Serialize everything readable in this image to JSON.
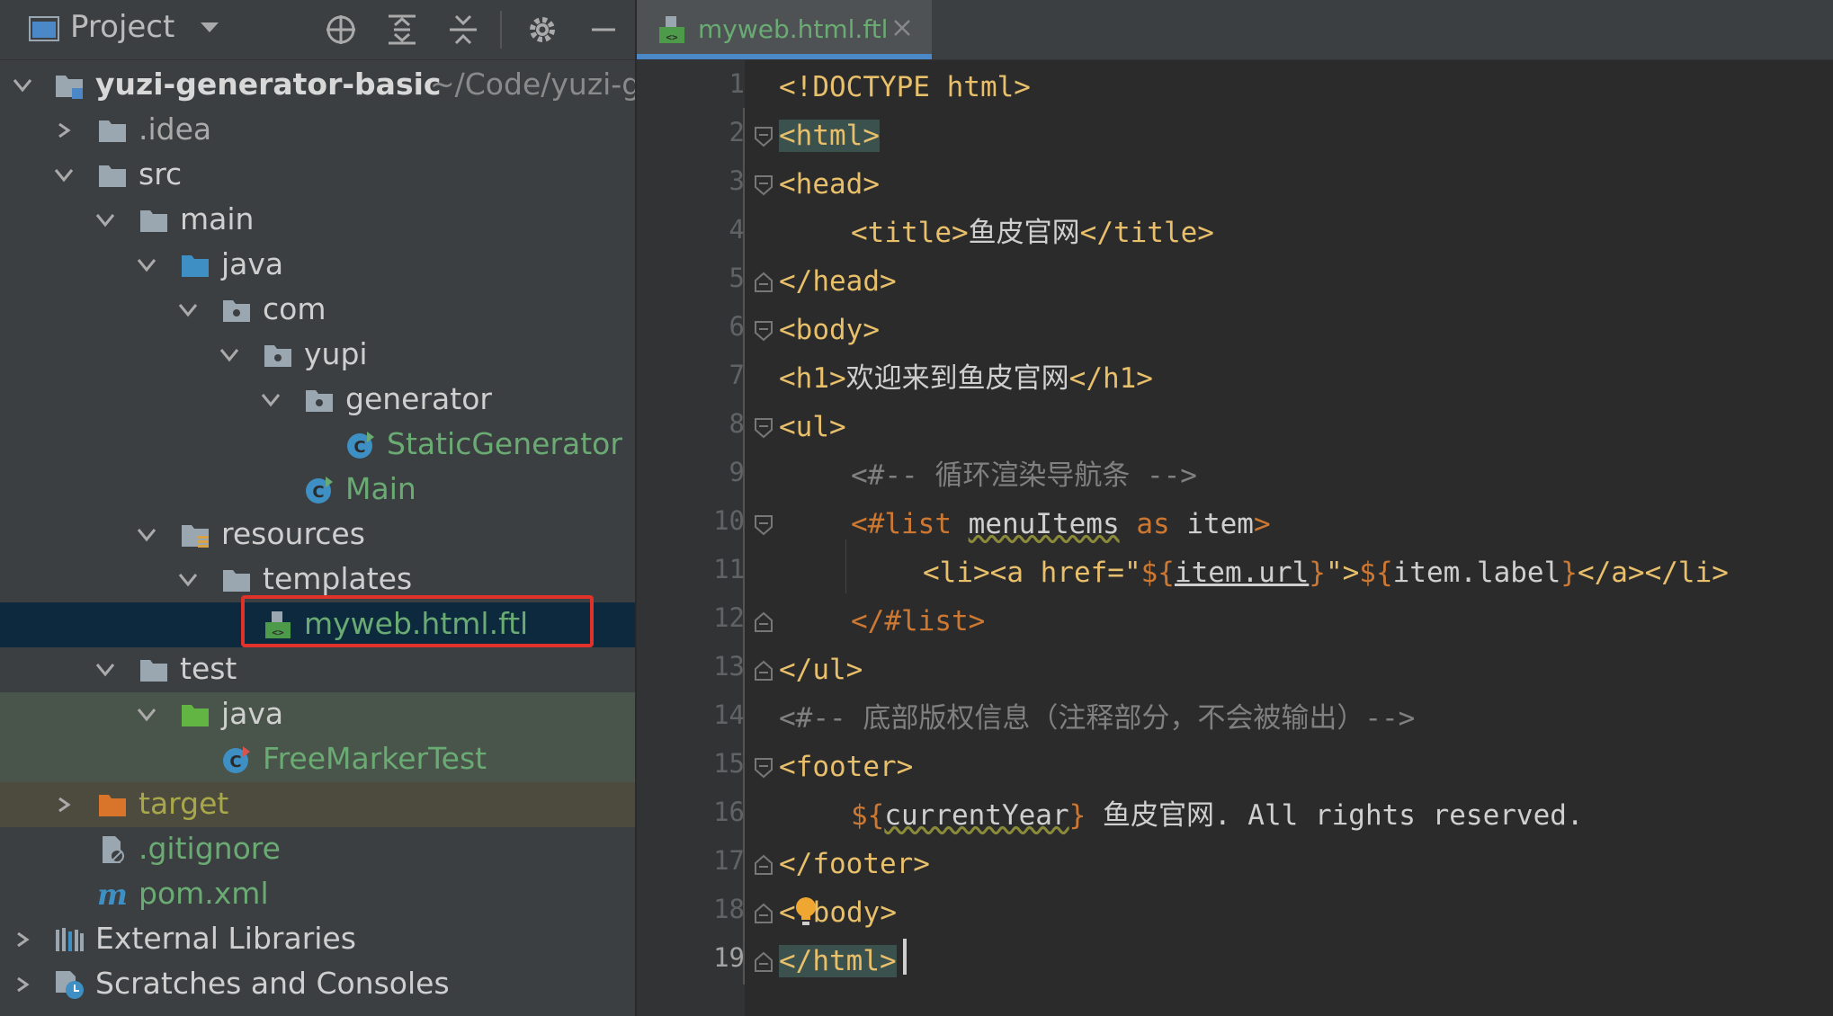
{
  "project_panel": {
    "title": "Project",
    "toolbar_icons": [
      "crosshair-icon",
      "expand-all-icon",
      "collapse-all-icon",
      "gear-icon",
      "minimize-icon"
    ]
  },
  "tree": [
    {
      "label": "yuzi-generator-basic",
      "suffix": "~/Code/yuzi-g",
      "icon": "module-folder-icon",
      "expanded": true
    },
    {
      "label": ".idea",
      "icon": "folder-icon",
      "expanded": false
    },
    {
      "label": "src",
      "icon": "folder-icon",
      "expanded": true
    },
    {
      "label": "main",
      "icon": "folder-icon",
      "expanded": true
    },
    {
      "label": "java",
      "icon": "source-folder-icon",
      "expanded": true
    },
    {
      "label": "com",
      "icon": "package-icon",
      "expanded": true
    },
    {
      "label": "yupi",
      "icon": "package-icon",
      "expanded": true
    },
    {
      "label": "generator",
      "icon": "package-icon",
      "expanded": true
    },
    {
      "label": "StaticGenerator",
      "icon": "java-class-icon"
    },
    {
      "label": "Main",
      "icon": "java-class-icon"
    },
    {
      "label": "resources",
      "icon": "resources-folder-icon",
      "expanded": true
    },
    {
      "label": "templates",
      "icon": "folder-icon",
      "expanded": true
    },
    {
      "label": "myweb.html.ftl",
      "icon": "ftl-file-icon",
      "selected": true
    },
    {
      "label": "test",
      "icon": "folder-icon",
      "expanded": true
    },
    {
      "label": "java",
      "icon": "test-source-folder-icon",
      "expanded": true
    },
    {
      "label": "FreeMarkerTest",
      "icon": "java-class-icon"
    },
    {
      "label": "target",
      "icon": "excluded-folder-icon",
      "expanded": false
    },
    {
      "label": ".gitignore",
      "icon": "gitignore-file-icon"
    },
    {
      "label": "pom.xml",
      "icon": "maven-icon"
    },
    {
      "label": "External Libraries",
      "icon": "libraries-icon",
      "expanded": false
    },
    {
      "label": "Scratches and Consoles",
      "icon": "scratches-icon",
      "expanded": false
    }
  ],
  "editor": {
    "tab": {
      "label": "myweb.html.ftl",
      "icon": "ftl-file-icon"
    },
    "line_numbers": [
      "1",
      "2",
      "3",
      "4",
      "5",
      "6",
      "7",
      "8",
      "9",
      "10",
      "11",
      "12",
      "13",
      "14",
      "15",
      "16",
      "17",
      "18",
      "19"
    ],
    "current_line": "19",
    "code": {
      "l1": "<!DOCTYPE html>",
      "l2": "<html>",
      "l3": "<head>",
      "l4_open": "<title>",
      "l4_text": "鱼皮官网",
      "l4_close": "</title>",
      "l5": "</head>",
      "l6": "<body>",
      "l7_open": "<h1>",
      "l7_text": "欢迎来到鱼皮官网",
      "l7_close": "</h1>",
      "l8": "<ul>",
      "l9": "<#-- 循环渲染导航条 -->",
      "l10_kw": "<#list",
      "l10_var": "menuItems",
      "l10_as": "as",
      "l10_item": "item",
      "l10_end": ">",
      "l11_a": "<li><a href=",
      "l11_q1": "\"",
      "l11_d1": "${",
      "l11_v1": "item.url",
      "l11_c1": "}",
      "l11_q2": "\"",
      "l11_gt": ">",
      "l11_d2": "${",
      "l11_v2": "item.label",
      "l11_c2": "}",
      "l11_end": "</a></li>",
      "l12": "</#list>",
      "l13": "</ul>",
      "l14": "<#-- 底部版权信息（注释部分，不会被输出）-->",
      "l15": "<footer>",
      "l16_d": "${",
      "l16_v": "currentYear",
      "l16_c": "}",
      "l16_text": " 鱼皮官网. All rights reserved.",
      "l17": "</footer>",
      "l18_lt": "<",
      "l18_rest": "body>",
      "l19": "</html>"
    }
  },
  "colors": {
    "panel_bg": "#3c3f41",
    "editor_bg": "#2b2b2b",
    "selection": "#0d293e",
    "highlight_box": "#e0322b",
    "tag": "#e8bf6a",
    "ftl_keyword": "#cc7832",
    "comment": "#808080",
    "class_name": "#6aab73"
  }
}
